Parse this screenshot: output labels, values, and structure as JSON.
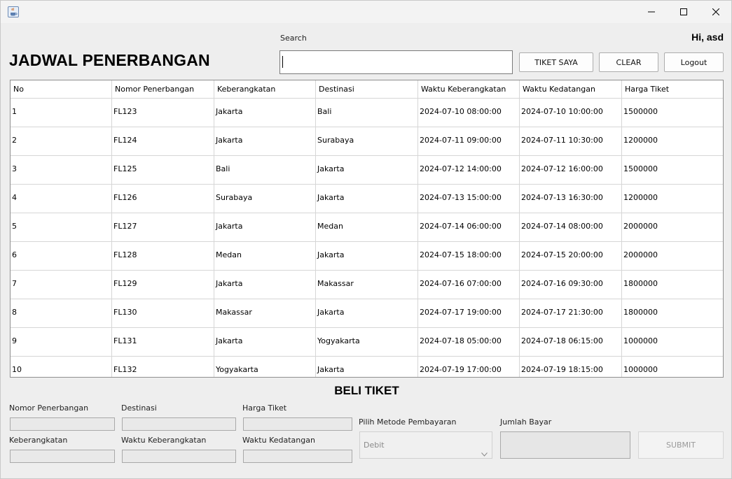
{
  "window": {
    "icon": "java-coffee-cup-icon",
    "controls": {
      "minimize": "minimize-icon",
      "maximize": "maximize-icon",
      "close": "close-icon"
    }
  },
  "header": {
    "title": "JADWAL PENERBANGAN",
    "greeting": "Hi, asd",
    "search_label": "Search",
    "search_value": ""
  },
  "buttons": {
    "my_tickets": "TIKET SAYA",
    "clear": "CLEAR",
    "logout": "Logout"
  },
  "table": {
    "columns": [
      "No",
      "Nomor Penerbangan",
      "Keberangkatan",
      "Destinasi",
      "Waktu Keberangkatan",
      "Waktu Kedatangan",
      "Harga Tiket"
    ],
    "rows": [
      [
        "1",
        "FL123",
        "Jakarta",
        "Bali",
        "2024-07-10 08:00:00",
        "2024-07-10 10:00:00",
        "1500000"
      ],
      [
        "2",
        "FL124",
        "Jakarta",
        "Surabaya",
        "2024-07-11 09:00:00",
        "2024-07-11 10:30:00",
        "1200000"
      ],
      [
        "3",
        "FL125",
        "Bali",
        "Jakarta",
        "2024-07-12 14:00:00",
        "2024-07-12 16:00:00",
        "1500000"
      ],
      [
        "4",
        "FL126",
        "Surabaya",
        "Jakarta",
        "2024-07-13 15:00:00",
        "2024-07-13 16:30:00",
        "1200000"
      ],
      [
        "5",
        "FL127",
        "Jakarta",
        "Medan",
        "2024-07-14 06:00:00",
        "2024-07-14 08:00:00",
        "2000000"
      ],
      [
        "6",
        "FL128",
        "Medan",
        "Jakarta",
        "2024-07-15 18:00:00",
        "2024-07-15 20:00:00",
        "2000000"
      ],
      [
        "7",
        "FL129",
        "Jakarta",
        "Makassar",
        "2024-07-16 07:00:00",
        "2024-07-16 09:30:00",
        "1800000"
      ],
      [
        "8",
        "FL130",
        "Makassar",
        "Jakarta",
        "2024-07-17 19:00:00",
        "2024-07-17 21:30:00",
        "1800000"
      ],
      [
        "9",
        "FL131",
        "Jakarta",
        "Yogyakarta",
        "2024-07-18 05:00:00",
        "2024-07-18 06:15:00",
        "1000000"
      ],
      [
        "10",
        "FL132",
        "Yogyakarta",
        "Jakarta",
        "2024-07-19 17:00:00",
        "2024-07-19 18:15:00",
        "1000000"
      ]
    ]
  },
  "purchase": {
    "title": "BELI TIKET",
    "labels": {
      "flight_number": "Nomor Penerbangan",
      "destination": "Destinasi",
      "price": "Harga Tiket",
      "departure": "Keberangkatan",
      "departure_time": "Waktu Keberangkatan",
      "arrival_time": "Waktu Kedatangan",
      "payment_method": "Pilih Metode Pembayaran",
      "amount": "Jumlah Bayar"
    },
    "payment_selected": "Debit",
    "submit": "SUBMIT"
  }
}
